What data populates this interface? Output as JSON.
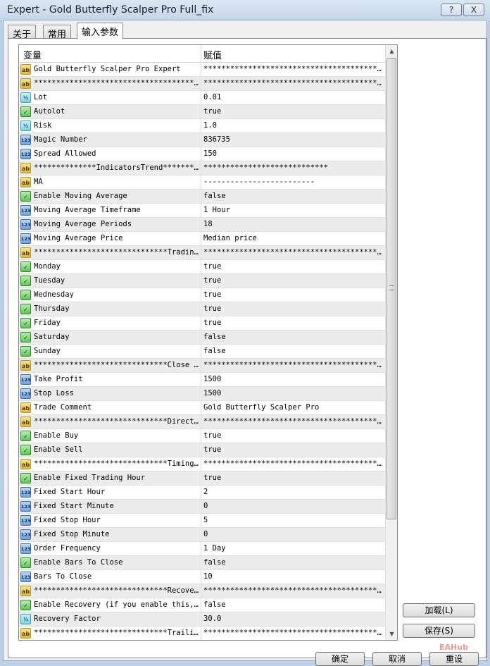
{
  "window": {
    "title": "Expert - Gold Butterfly Scalper Pro Full_fix",
    "help_label": "?",
    "close_label": "X"
  },
  "tabs": [
    {
      "label": "关于"
    },
    {
      "label": "常用"
    },
    {
      "label": "输入参数"
    }
  ],
  "table": {
    "headers": [
      "变量",
      "赋值"
    ],
    "rows": [
      {
        "icon": "ab",
        "name": "Gold Butterfly Scalper Pro Expert",
        "value": "*****************************************..."
      },
      {
        "icon": "ab",
        "name": "***************************************...",
        "value": "*****************************************..."
      },
      {
        "icon": "dbl",
        "name": "Lot",
        "value": "0.01"
      },
      {
        "icon": "bool",
        "name": "Autolot",
        "value": "true"
      },
      {
        "icon": "dbl",
        "name": "Risk",
        "value": "1.0"
      },
      {
        "icon": "int",
        "name": "Magic Number",
        "value": "836735"
      },
      {
        "icon": "int",
        "name": "Spread Allowed",
        "value": "150"
      },
      {
        "icon": "ab",
        "name": "**************IndicatorsTrend*******...",
        "value": "****************************"
      },
      {
        "icon": "ab",
        "name": "MA",
        "value": "-------------------------"
      },
      {
        "icon": "bool",
        "name": "Enable Moving Average",
        "value": "false"
      },
      {
        "icon": "int",
        "name": "Moving Average Timeframe",
        "value": "1 Hour"
      },
      {
        "icon": "int",
        "name": "Moving Average Periods",
        "value": "18"
      },
      {
        "icon": "int",
        "name": "Moving Average Price",
        "value": "Median price"
      },
      {
        "icon": "ab",
        "name": "******************************Tradin...",
        "value": "*****************************************..."
      },
      {
        "icon": "bool",
        "name": "Monday",
        "value": "true"
      },
      {
        "icon": "bool",
        "name": "Tuesday",
        "value": "true"
      },
      {
        "icon": "bool",
        "name": "Wednesday",
        "value": "true"
      },
      {
        "icon": "bool",
        "name": "Thursday",
        "value": "true"
      },
      {
        "icon": "bool",
        "name": "Friday",
        "value": "true"
      },
      {
        "icon": "bool",
        "name": "Saturday",
        "value": "false"
      },
      {
        "icon": "bool",
        "name": "Sunday",
        "value": "false"
      },
      {
        "icon": "ab",
        "name": "******************************Close ...",
        "value": "*****************************************..."
      },
      {
        "icon": "int",
        "name": "Take Profit",
        "value": "1500"
      },
      {
        "icon": "int",
        "name": "Stop Loss",
        "value": "1500"
      },
      {
        "icon": "ab",
        "name": "Trade Comment",
        "value": "Gold Butterfly Scalper Pro"
      },
      {
        "icon": "ab",
        "name": "******************************Direct...",
        "value": "*****************************************..."
      },
      {
        "icon": "bool",
        "name": "Enable Buy",
        "value": "true"
      },
      {
        "icon": "bool",
        "name": "Enable Sell",
        "value": "true"
      },
      {
        "icon": "ab",
        "name": "******************************Timing...",
        "value": "*****************************************..."
      },
      {
        "icon": "bool",
        "name": "Enable Fixed Trading Hour",
        "value": "true"
      },
      {
        "icon": "int",
        "name": "Fixed Start Hour",
        "value": "2"
      },
      {
        "icon": "int",
        "name": "Fixed Start Minute",
        "value": "0"
      },
      {
        "icon": "int",
        "name": "Fixed Stop Hour",
        "value": "5"
      },
      {
        "icon": "int",
        "name": "Fixed Stop Minute",
        "value": "0"
      },
      {
        "icon": "int",
        "name": "Order Frequency",
        "value": "1 Day"
      },
      {
        "icon": "bool",
        "name": "Enable Bars To Close",
        "value": "false"
      },
      {
        "icon": "int",
        "name": "Bars To Close",
        "value": "10"
      },
      {
        "icon": "ab",
        "name": "******************************Recove...",
        "value": "*****************************************..."
      },
      {
        "icon": "bool",
        "name": "Enable Recovery (if you enable this,...",
        "value": "false"
      },
      {
        "icon": "dbl",
        "name": "Recovery Factor",
        "value": "30.0"
      },
      {
        "icon": "ab",
        "name": "******************************Traili...",
        "value": "*****************************************..."
      }
    ]
  },
  "icon_glyphs": {
    "ab": "ab",
    "dbl": "½",
    "int": "123",
    "bool": "✓"
  },
  "buttons": {
    "load": "加载(L)",
    "save": "保存(S)",
    "ok": "确定",
    "cancel": "取消",
    "reset": "重设"
  },
  "watermark": "EAHub"
}
